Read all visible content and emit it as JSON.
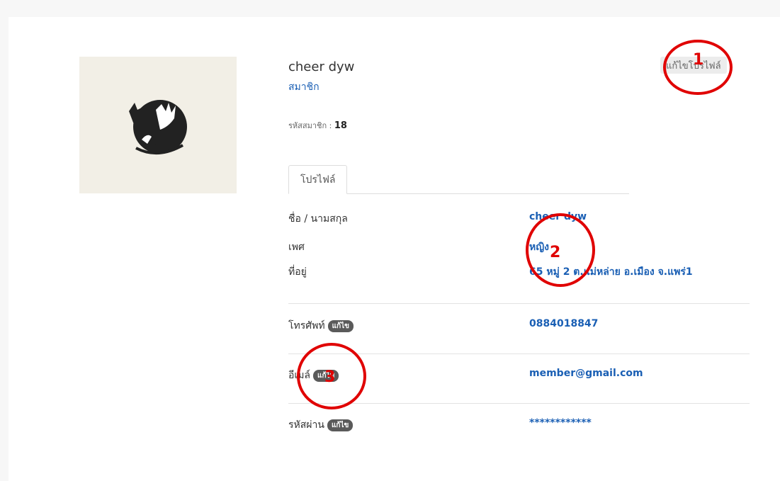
{
  "profile": {
    "name": "cheer dyw",
    "role": "สมาชิก",
    "member_id_label": "รหัสสมาชิก :",
    "member_id": "18",
    "edit_profile": "แก้ไขโปรไฟล์"
  },
  "tabs": [
    {
      "label": "โปรไฟล์"
    }
  ],
  "details": {
    "name_label": "ชื่อ / นามสกุล",
    "name_value": "cheer dyw",
    "gender_label": "เพศ",
    "gender_value": "หญิง",
    "address_label": "ที่อยู่",
    "address_value": "65 หมู่ 2 ต.แม่หล่าย อ.เมือง จ.แพร่1",
    "phone_label": "โทรศัพท์",
    "phone_value": "0884018847",
    "email_label": "อีเมล์",
    "email_value": "member@gmail.com",
    "password_label": "รหัสผ่าน",
    "password_value": "************",
    "edit_badge": "แก้ไข"
  },
  "annotations": [
    "1",
    "2",
    "3"
  ],
  "colors": {
    "accent": "#1a5fb4",
    "annotation": "#e00000",
    "avatar_bg": "#f2efe6"
  }
}
